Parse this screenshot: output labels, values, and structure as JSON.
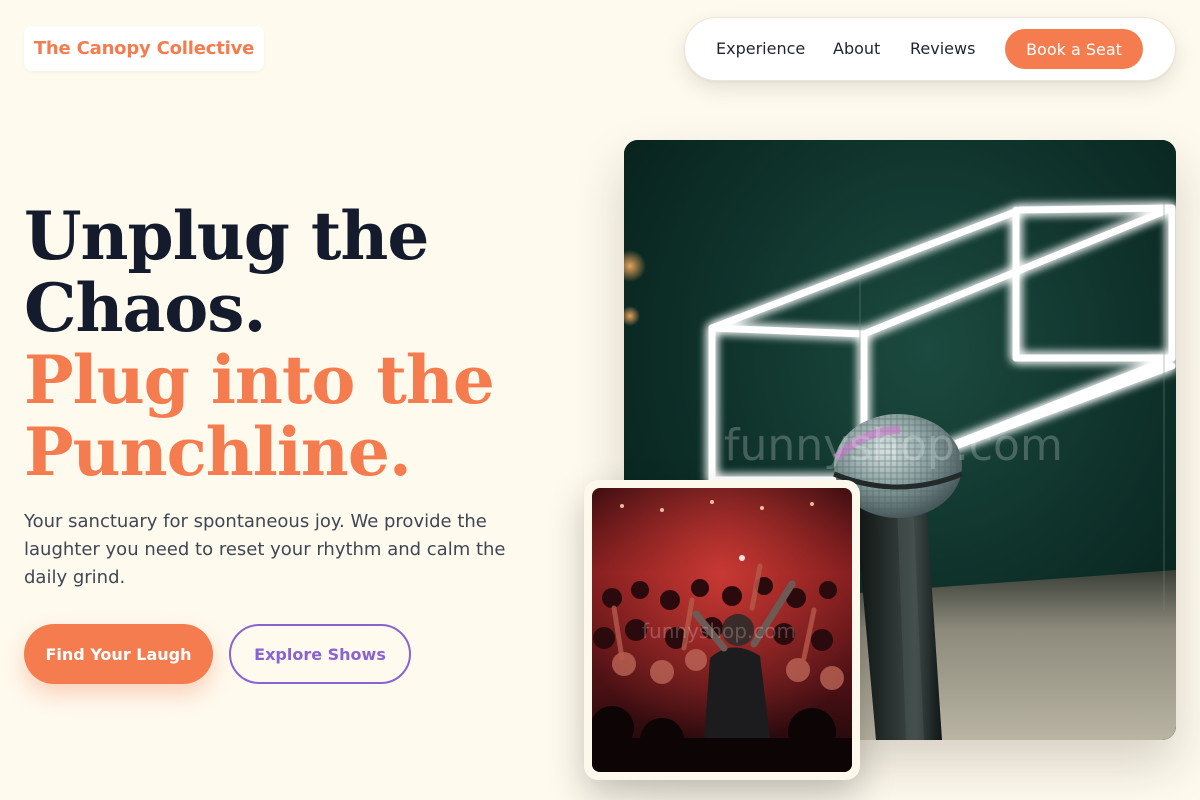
{
  "brand": {
    "name": "The Canopy Collective"
  },
  "nav": {
    "links": [
      "Experience",
      "About",
      "Reviews"
    ],
    "cta_label": "Book a Seat"
  },
  "hero": {
    "headline_line1": "Unplug the",
    "headline_line2": "Chaos.",
    "accent_line1": "Plug into the",
    "accent_line2": "Punchline.",
    "description": "Your sanctuary for spontaneous joy. We provide the laughter you need to reset your rhythm and calm the daily grind.",
    "primary_cta": "Find Your Laugh",
    "secondary_cta": "Explore Shows"
  },
  "images": {
    "stage_watermark": "funnyshop.com",
    "crowd_watermark": "funnyshop.com"
  },
  "colors": {
    "background": "#fefaee",
    "accent": "#f47c4f",
    "heading": "#131b2c",
    "secondary": "#8a63d2"
  },
  "icons": [
    "microphone",
    "neon-cube",
    "crowd"
  ]
}
